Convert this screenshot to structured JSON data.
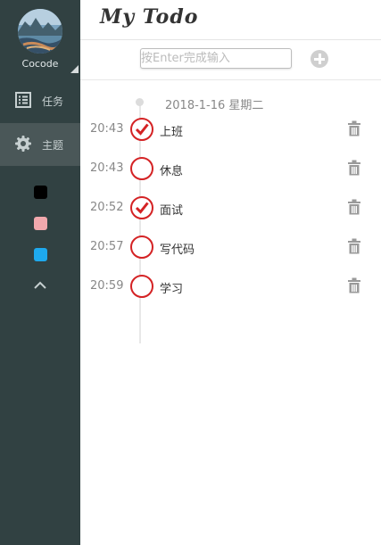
{
  "user": {
    "name": "Cocode"
  },
  "nav": {
    "tasks_label": "任务",
    "theme_label": "主题"
  },
  "theme_colors": [
    "#000000",
    "#f1a8ad",
    "#1ea9ee"
  ],
  "header": {
    "title": "My Todo"
  },
  "input": {
    "placeholder": "按Enter完成输入",
    "value": ""
  },
  "date": "2018-1-16 星期二",
  "tasks": [
    {
      "time": "20:43",
      "text": "上班",
      "done": true
    },
    {
      "time": "20:43",
      "text": "休息",
      "done": false
    },
    {
      "time": "20:52",
      "text": "面试",
      "done": true
    },
    {
      "time": "20:57",
      "text": "写代码",
      "done": false
    },
    {
      "time": "20:59",
      "text": "学习",
      "done": false
    }
  ],
  "colors": {
    "sidebar": "#314142",
    "sidebar_active": "#4a5758",
    "check_red": "#d42224"
  },
  "icons": [
    "list-icon",
    "gear-icon",
    "chevron-up-icon",
    "trash-icon",
    "plus-icon",
    "checkmark-icon",
    "caret-corner-icon"
  ]
}
